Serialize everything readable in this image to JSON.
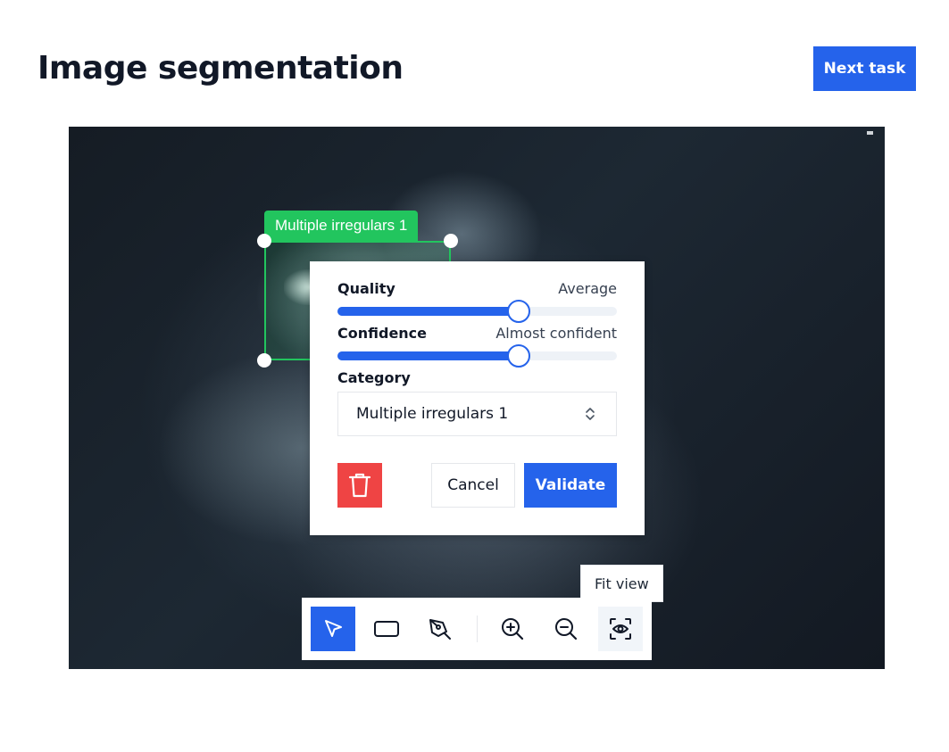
{
  "header": {
    "title": "Image segmentation",
    "next_button_label": "Next task"
  },
  "annotation": {
    "label": "Multiple irregulars 1",
    "color": "#22c55e"
  },
  "popup": {
    "quality": {
      "label": "Quality",
      "value_text": "Average",
      "level": 0.65
    },
    "confidence": {
      "label": "Confidence",
      "value_text": "Almost confident",
      "level": 0.65
    },
    "category": {
      "label": "Category",
      "selected": "Multiple irregulars 1"
    },
    "delete_icon": "trash-icon",
    "cancel_label": "Cancel",
    "validate_label": "Validate"
  },
  "toolbar": {
    "tooltip": "Fit view",
    "tools": [
      {
        "name": "select-tool",
        "icon": "cursor-arrow-icon",
        "active": true
      },
      {
        "name": "rectangle-tool",
        "icon": "rectangle-icon",
        "active": false
      },
      {
        "name": "pen-tool",
        "icon": "pen-icon",
        "active": false
      },
      {
        "name": "zoom-in-tool",
        "icon": "zoom-in-icon",
        "active": false
      },
      {
        "name": "zoom-out-tool",
        "icon": "zoom-out-icon",
        "active": false
      },
      {
        "name": "fit-view-tool",
        "icon": "fit-view-icon",
        "active": false
      }
    ]
  },
  "colors": {
    "accent": "#2563eb",
    "danger": "#ef4444",
    "annotation": "#22c55e"
  }
}
